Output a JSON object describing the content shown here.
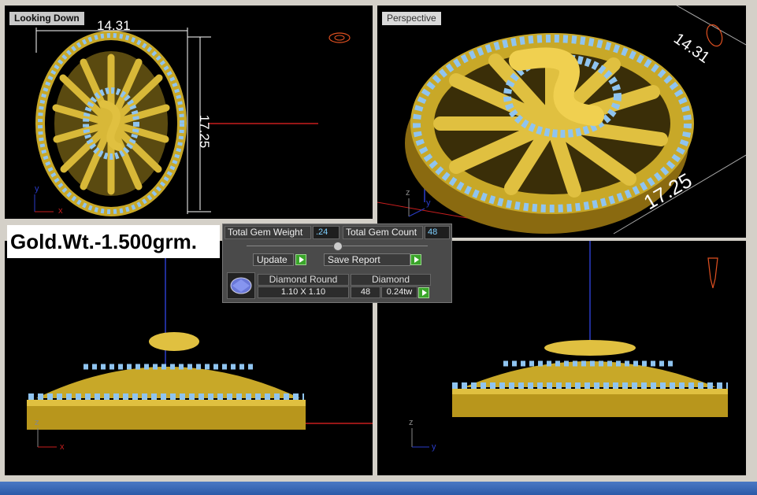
{
  "viewports": {
    "top": {
      "title": "Looking Down"
    },
    "perspective": {
      "title": "Perspective"
    },
    "front": {},
    "right": {}
  },
  "dimensions": {
    "top_width": "14.31",
    "top_height": "17.25",
    "persp_a": "14.31",
    "persp_b": "17.25"
  },
  "axes": {
    "y": "y",
    "x": "x",
    "z": "z"
  },
  "gold_weight": "Gold.Wt.-1.500grm.",
  "gem_panel": {
    "total_gem_weight_label": "Total Gem Weight",
    "total_gem_weight_value": ".24",
    "total_gem_count_label": "Total Gem Count",
    "total_gem_count_value": "48",
    "update_label": "Update",
    "save_report_label": "Save Report",
    "gem_row": {
      "shape_header": "Diamond Round",
      "size": "1.10 X 1.10",
      "type_header": "Diamond",
      "count": "48",
      "weight": "0.24tw"
    }
  },
  "colors": {
    "gold": "#c8a828",
    "gem": "#8fc4f0",
    "grid_red": "#c81e1e",
    "grid_blue": "#2a3cc8"
  }
}
